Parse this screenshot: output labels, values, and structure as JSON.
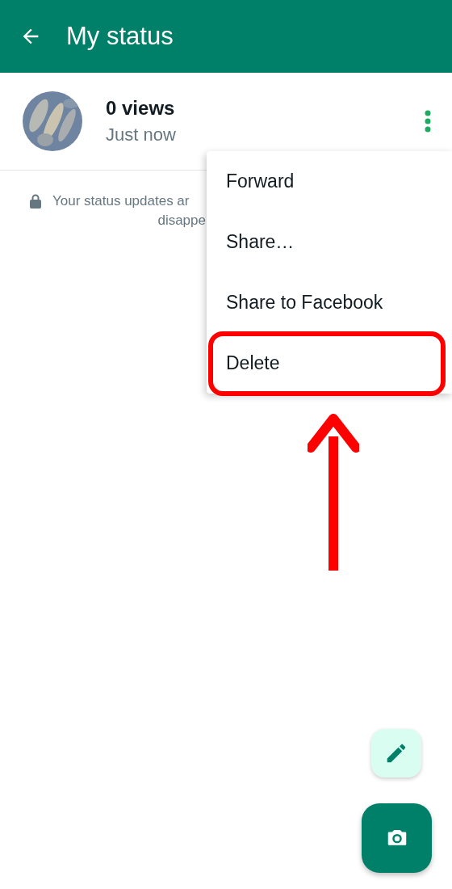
{
  "header": {
    "title": "My status"
  },
  "status": {
    "views": "0 views",
    "time": "Just now"
  },
  "notice": {
    "lines": [
      "Your status updates ar",
      "disappe"
    ]
  },
  "menu": {
    "items": [
      {
        "label": "Forward",
        "highlighted": false
      },
      {
        "label": "Share…",
        "highlighted": false
      },
      {
        "label": "Share to Facebook",
        "highlighted": false
      },
      {
        "label": "Delete",
        "highlighted": true
      }
    ]
  }
}
